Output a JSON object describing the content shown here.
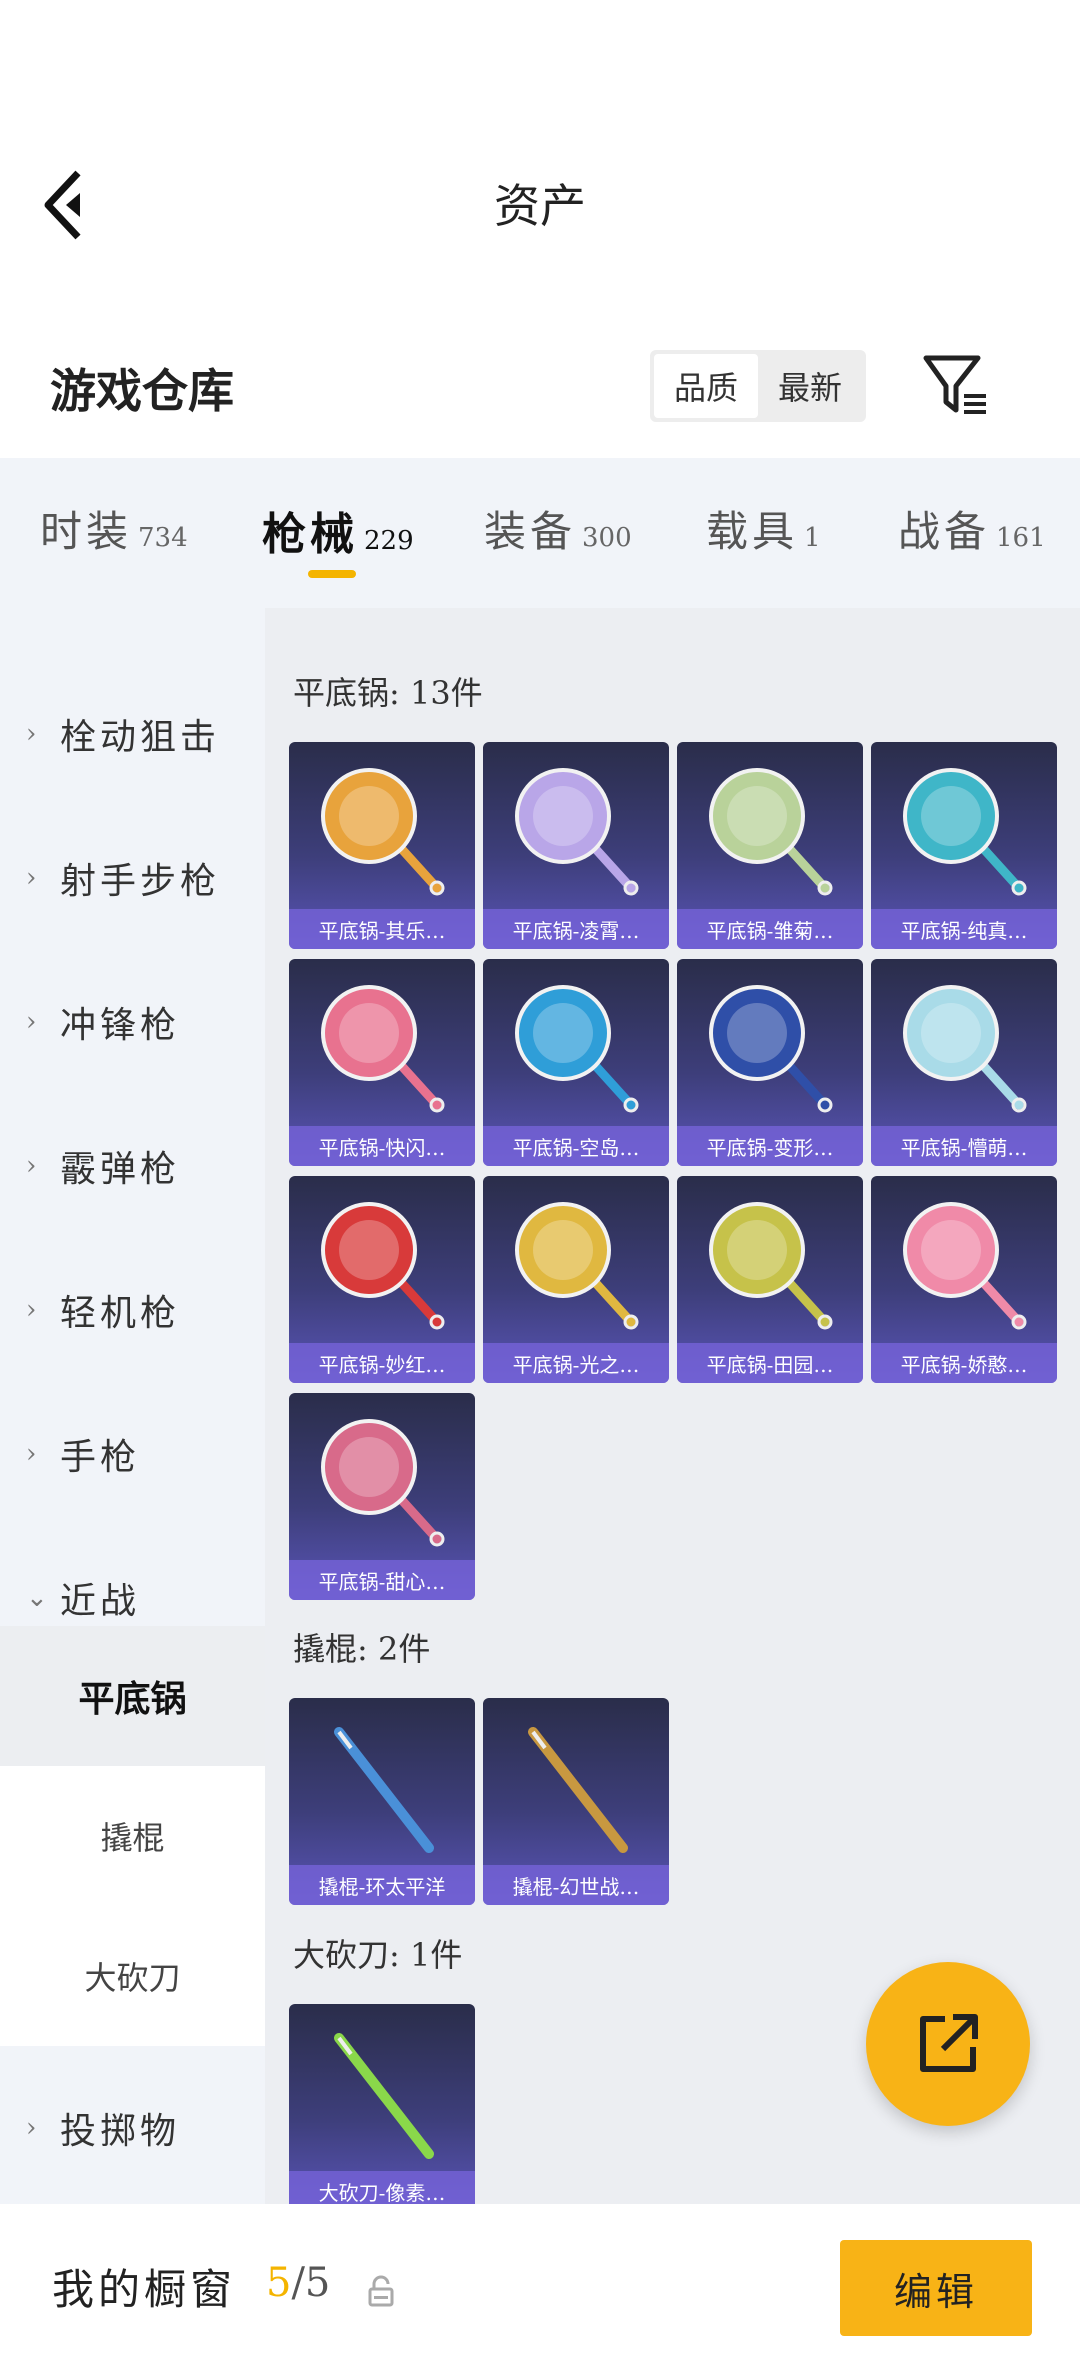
{
  "header": {
    "title": "资产"
  },
  "section": {
    "title": "游戏仓库",
    "sort_options": [
      "品质",
      "最新"
    ],
    "active_sort": "品质"
  },
  "tabs": [
    {
      "label": "时装",
      "count": "734"
    },
    {
      "label": "枪械",
      "count": "229",
      "active": true
    },
    {
      "label": "装备",
      "count": "300"
    },
    {
      "label": "载具",
      "count": "1"
    },
    {
      "label": "战备",
      "count": "161"
    }
  ],
  "sidebar": {
    "items": [
      {
        "label": "栓动狙击",
        "chevron": "›"
      },
      {
        "label": "射手步枪",
        "chevron": "›"
      },
      {
        "label": "冲锋枪",
        "chevron": "›"
      },
      {
        "label": "霰弹枪",
        "chevron": "›"
      },
      {
        "label": "轻机枪",
        "chevron": "›"
      },
      {
        "label": "手枪",
        "chevron": "›"
      },
      {
        "label": "近战",
        "chevron": "⌄"
      }
    ],
    "sub_items": [
      {
        "label": "平底锅",
        "active": true
      },
      {
        "label": "撬棍"
      },
      {
        "label": "大砍刀"
      }
    ],
    "last_item": {
      "label": "投掷物",
      "chevron": "›"
    }
  },
  "groups": [
    {
      "title": "平底锅: 13件",
      "items": [
        {
          "label": "平底锅-其乐…",
          "color": "#e8a33c"
        },
        {
          "label": "平底锅-凌霄…",
          "color": "#b9a6e8"
        },
        {
          "label": "平底锅-雏菊…",
          "color": "#b9d29a"
        },
        {
          "label": "平底锅-纯真…",
          "color": "#3fb6c8"
        },
        {
          "label": "平底锅-快闪…",
          "color": "#e8728f"
        },
        {
          "label": "平底锅-空岛…",
          "color": "#2f9ed8"
        },
        {
          "label": "平底锅-变形…",
          "color": "#2f4fa8"
        },
        {
          "label": "平底锅-懵萌…",
          "color": "#a9dbe8"
        },
        {
          "label": "平底锅-妙红…",
          "color": "#d83a3a"
        },
        {
          "label": "平底锅-光之…",
          "color": "#e0b840"
        },
        {
          "label": "平底锅-田园…",
          "color": "#c6c24a"
        },
        {
          "label": "平底锅-娇憨…",
          "color": "#f08aa8"
        },
        {
          "label": "平底锅-甜心…",
          "color": "#d86a8a"
        }
      ]
    },
    {
      "title": "撬棍: 2件",
      "items": [
        {
          "label": "撬棍-环太平洋",
          "color": "#4a90d8"
        },
        {
          "label": "撬棍-幻世战…",
          "color": "#c89840"
        }
      ]
    },
    {
      "title": "大砍刀: 1件",
      "items": [
        {
          "label": "大砍刀-像素…",
          "color": "#8ad84a"
        }
      ]
    }
  ],
  "bottom": {
    "showcase_label": "我的橱窗",
    "showcase_current": "5",
    "showcase_total": "/5",
    "edit_label": "编辑"
  },
  "icons": {
    "back": "chevron-left-icon",
    "filter": "filter-icon",
    "share": "external-link-icon",
    "lock": "lock-icon"
  }
}
